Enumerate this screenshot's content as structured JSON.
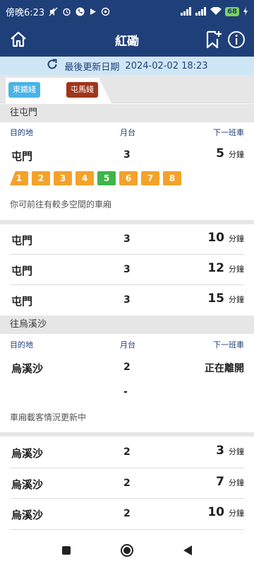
{
  "status_bar": {
    "time": "傍晚6:23",
    "battery": "68",
    "colors": {
      "bg": "#1f3f78"
    }
  },
  "app_bar": {
    "title": "紅磡",
    "icons": [
      "home-icon",
      "bookmark-add-icon",
      "info-icon"
    ]
  },
  "update": {
    "label": "最後更新日期",
    "datetime": "2024-02-02 18:23"
  },
  "tabs": [
    {
      "label": "東鐵綫",
      "color": "#4ab3e6",
      "selected": false
    },
    {
      "label": "屯馬綫",
      "color": "#a0361a",
      "selected": true
    }
  ],
  "columns": {
    "destination": "目的地",
    "platform": "月台",
    "next_train": "下一班車"
  },
  "minutes_unit": "分鐘",
  "directions": [
    {
      "header": "往屯門",
      "first": {
        "destination": "屯門",
        "platform": "3",
        "minutes": "5",
        "cars": [
          "1",
          "2",
          "3",
          "4",
          "5",
          "6",
          "7",
          "8"
        ],
        "least_crowded_car": "5",
        "note": "你可前往有較多空間的車廂"
      },
      "rows": [
        {
          "destination": "屯門",
          "platform": "3",
          "minutes": "10"
        },
        {
          "destination": "屯門",
          "platform": "3",
          "minutes": "12"
        },
        {
          "destination": "屯門",
          "platform": "3",
          "minutes": "15"
        }
      ]
    },
    {
      "header": "往烏溪沙",
      "first": {
        "destination": "烏溪沙",
        "platform": "2",
        "status": "正在離開",
        "dash": "-",
        "note": "車廂載客情況更新中"
      },
      "rows": [
        {
          "destination": "烏溪沙",
          "platform": "2",
          "minutes": "3"
        },
        {
          "destination": "烏溪沙",
          "platform": "2",
          "minutes": "7"
        },
        {
          "destination": "烏溪沙",
          "platform": "2",
          "minutes": "10"
        }
      ]
    }
  ],
  "car_colors": {
    "normal": "#f4a22a",
    "least_crowded": "#3fb54a"
  }
}
